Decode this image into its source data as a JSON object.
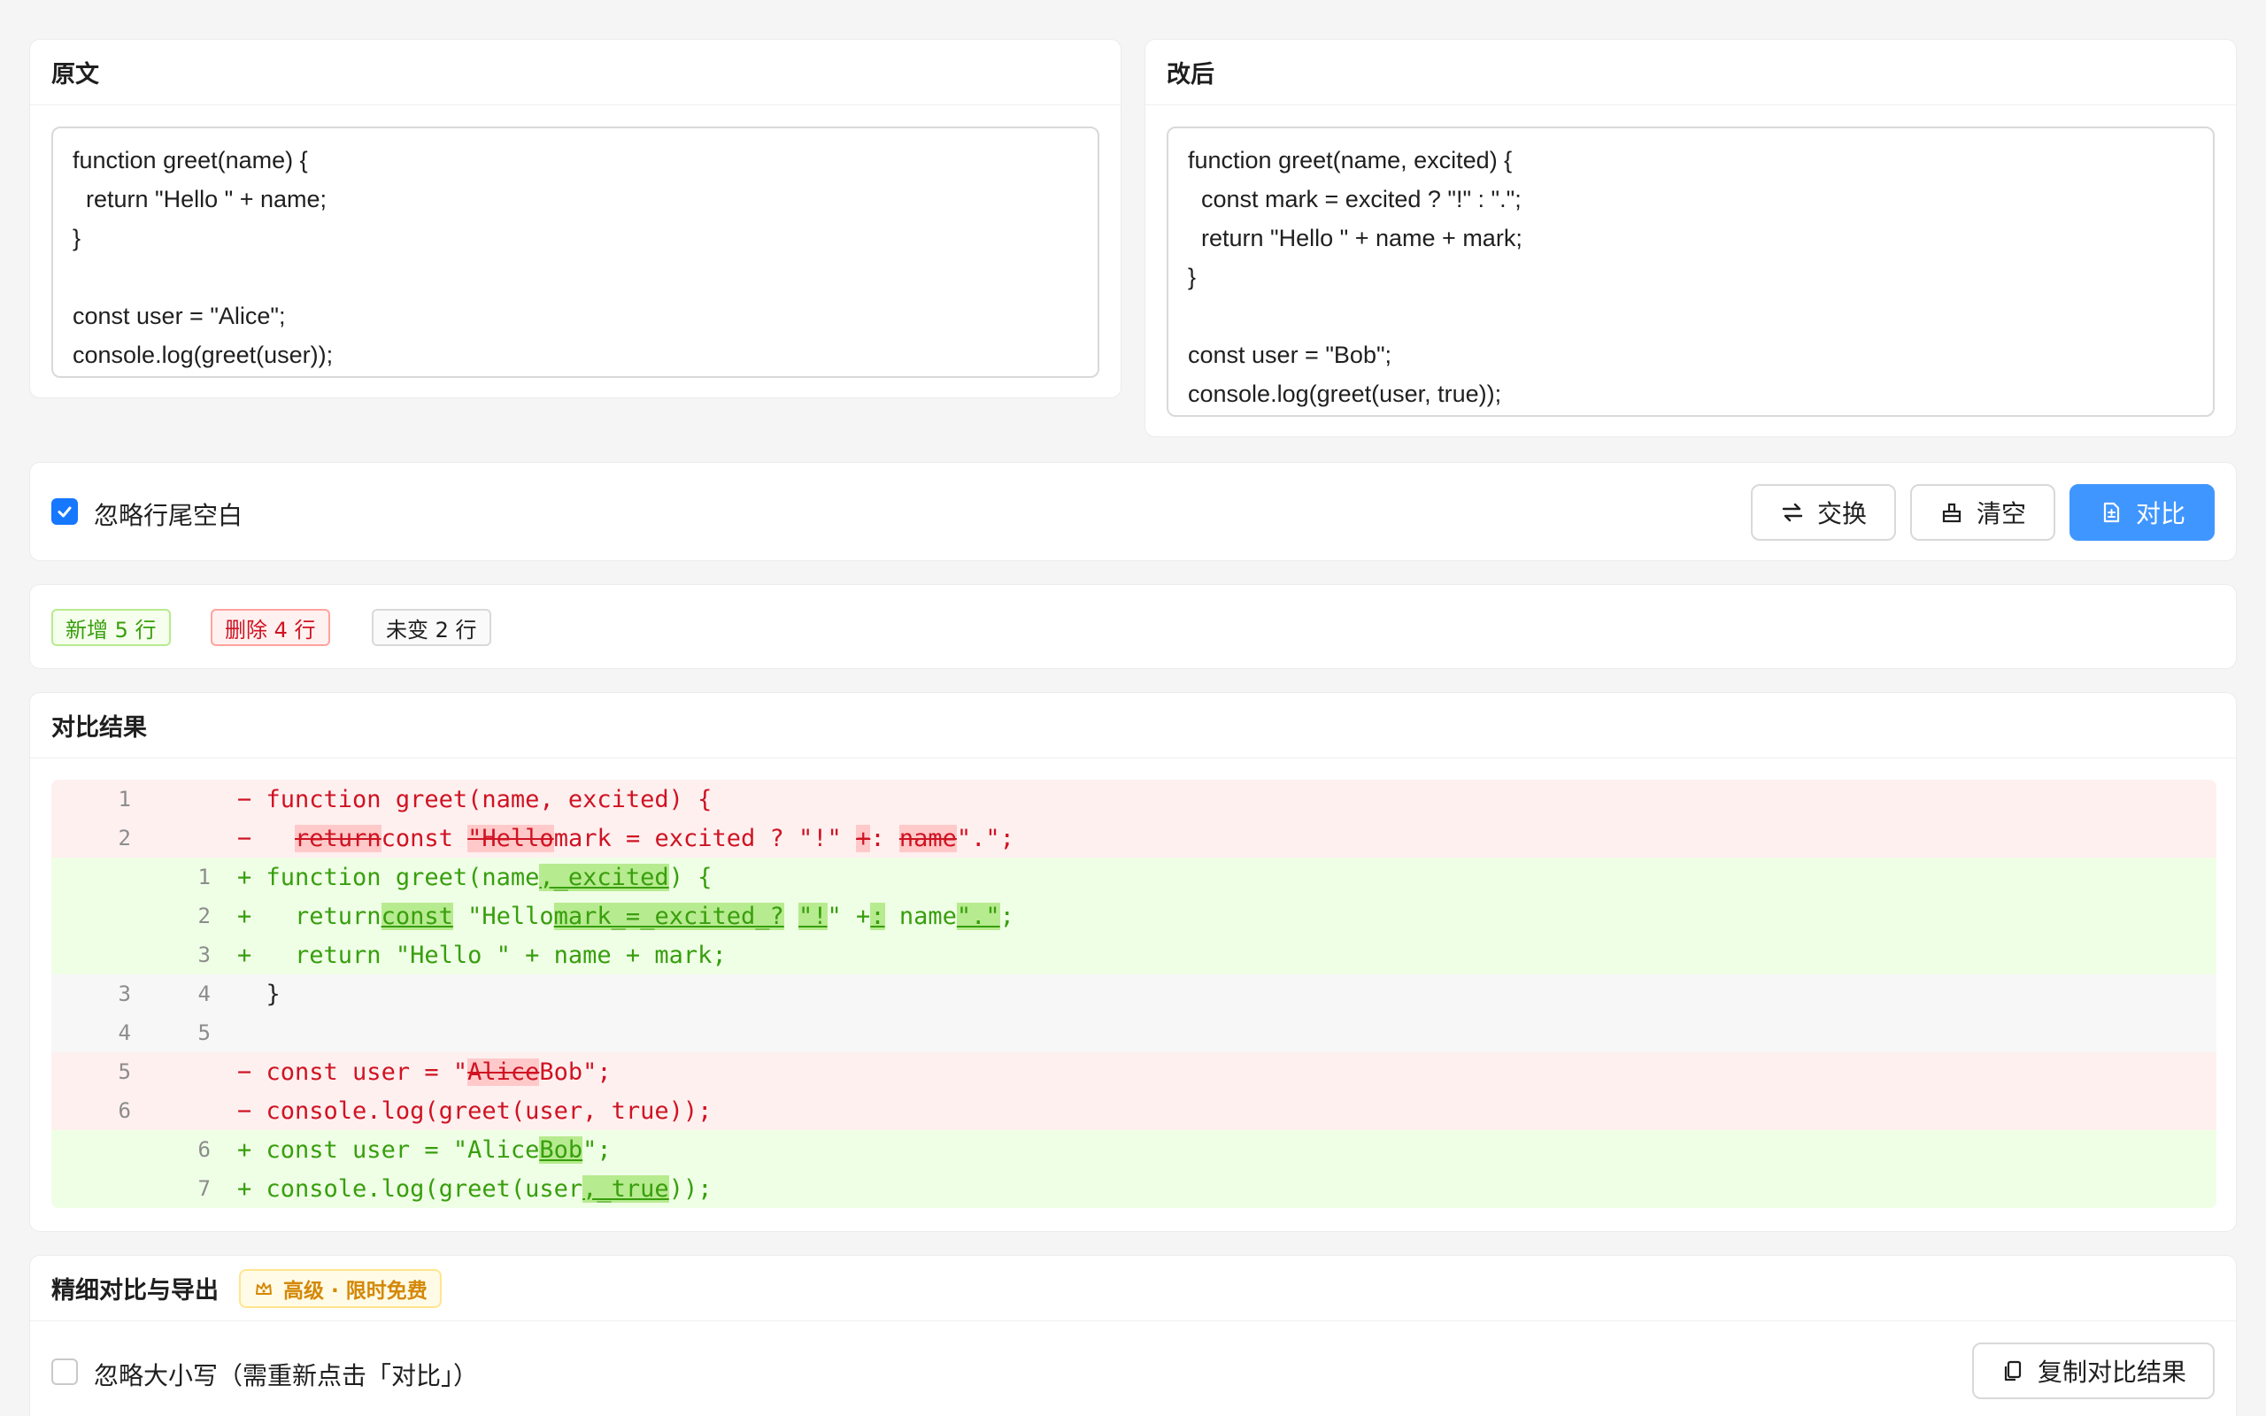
{
  "original": {
    "title": "原文",
    "lines": [
      "function greet(name) {",
      "  return \"Hello \" + name;",
      "}",
      "",
      "const user = \"Alice\";",
      "console.log(greet(user));"
    ]
  },
  "modified": {
    "title": "改后",
    "lines": [
      "function greet(name, excited) {",
      "  const mark = excited ? \"!\" : \".\";",
      "  return \"Hello \" + name + mark;",
      "}",
      "",
      "const user = \"Bob\";",
      "console.log(greet(user, true));"
    ]
  },
  "toolbar": {
    "ignore_trailing_ws_label": "忽略行尾空白",
    "ignore_trailing_ws_checked": true,
    "swap_label": "交换",
    "clear_label": "清空",
    "compare_label": "对比"
  },
  "stats": {
    "added": "新增 5 行",
    "deleted": "删除 4 行",
    "unchanged": "未变 2 行"
  },
  "result": {
    "title": "对比结果",
    "rows": [
      {
        "type": "del",
        "old": "1",
        "new": "",
        "sign": "−",
        "parts": [
          {
            "t": " function greet(name, excited) {"
          }
        ]
      },
      {
        "type": "del",
        "old": "2",
        "new": "",
        "sign": "−",
        "parts": [
          {
            "t": "   "
          },
          {
            "t": "return",
            "x": "del"
          },
          {
            "t": "const "
          },
          {
            "t": "\"Hello",
            "x": "del"
          },
          {
            "t": "mark = excited ? \"!\" "
          },
          {
            "t": "+",
            "x": "del"
          },
          {
            "t": ": "
          },
          {
            "t": "name",
            "x": "del"
          },
          {
            "t": "\".\";"
          }
        ]
      },
      {
        "type": "add",
        "old": "",
        "new": "1",
        "sign": "+",
        "parts": [
          {
            "t": " function greet(name"
          },
          {
            "t": ",_excited",
            "x": "add"
          },
          {
            "t": ") {"
          }
        ]
      },
      {
        "type": "add",
        "old": "",
        "new": "2",
        "sign": "+",
        "parts": [
          {
            "t": "   return"
          },
          {
            "t": "const",
            "x": "add"
          },
          {
            "t": " \"Hello"
          },
          {
            "t": "mark_=_excited_?",
            "x": "add"
          },
          {
            "t": " "
          },
          {
            "t": "\"!",
            "x": "add"
          },
          {
            "t": "\" +"
          },
          {
            "t": ":",
            "x": "add"
          },
          {
            "t": " name"
          },
          {
            "t": "\".\"",
            "x": "add"
          },
          {
            "t": ";"
          }
        ]
      },
      {
        "type": "add",
        "old": "",
        "new": "3",
        "sign": "+",
        "parts": [
          {
            "t": "   return \"Hello \" + name + mark;"
          }
        ]
      },
      {
        "type": "same",
        "old": "3",
        "new": "4",
        "sign": " ",
        "parts": [
          {
            "t": " }"
          }
        ]
      },
      {
        "type": "same",
        "old": "4",
        "new": "5",
        "sign": " ",
        "parts": [
          {
            "t": ""
          }
        ]
      },
      {
        "type": "del",
        "old": "5",
        "new": "",
        "sign": "−",
        "parts": [
          {
            "t": " const user = \""
          },
          {
            "t": "Alice",
            "x": "del"
          },
          {
            "t": "Bob\";"
          }
        ]
      },
      {
        "type": "del",
        "old": "6",
        "new": "",
        "sign": "−",
        "parts": [
          {
            "t": " console.log(greet(user, true));"
          }
        ]
      },
      {
        "type": "add",
        "old": "",
        "new": "6",
        "sign": "+",
        "parts": [
          {
            "t": " const user = \"Alice"
          },
          {
            "t": "Bob",
            "x": "add"
          },
          {
            "t": "\";"
          }
        ]
      },
      {
        "type": "add",
        "old": "",
        "new": "7",
        "sign": "+",
        "parts": [
          {
            "t": " console.log(greet(user"
          },
          {
            "t": ",_true",
            "x": "add"
          },
          {
            "t": "));"
          }
        ]
      }
    ]
  },
  "advanced": {
    "title": "精细对比与导出",
    "badge": "高级 · 限时免费",
    "ignore_case_label": "忽略大小写（需重新点击「对比」）",
    "ignore_case_checked": false,
    "copy_label": "复制对比结果"
  },
  "colors": {
    "primary": "#4096ff",
    "checkbox": "#1677ff",
    "added_text": "#389e0d",
    "deleted_text": "#cf1322",
    "added_bg": "#efffe6",
    "deleted_bg": "#fff0f0",
    "badge": "#d48806"
  }
}
